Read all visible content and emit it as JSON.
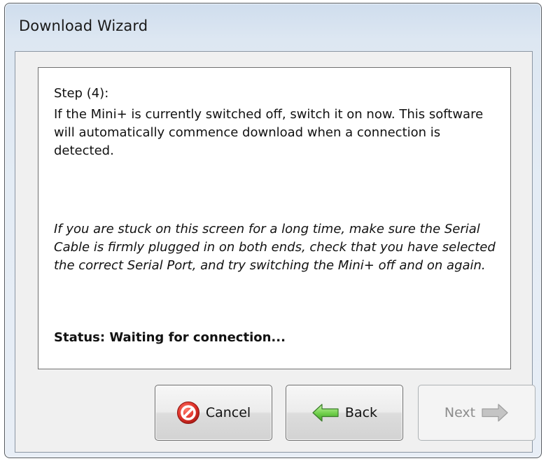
{
  "window": {
    "title": "Download Wizard"
  },
  "content": {
    "step_label": "Step (4):",
    "instructions": "If the Mini+ is currently switched off, switch it on now.  This software will automatically commence download when a connection is detected.",
    "hint": "If you are stuck on this screen for a long time, make sure the Serial Cable is firmly plugged in on both ends, check that you have selected the correct Serial Port, and try switching the Mini+ off and on again.",
    "status": "Status: Waiting for connection..."
  },
  "buttons": {
    "cancel": {
      "label": "Cancel",
      "icon": "cancel-icon",
      "enabled": true
    },
    "back": {
      "label": "Back",
      "icon": "left-arrow-icon",
      "enabled": true
    },
    "next": {
      "label": "Next",
      "icon": "right-arrow-icon",
      "enabled": false
    }
  },
  "colors": {
    "cancel_icon_red": "#e0322a",
    "back_arrow_green": "#6fcf4a",
    "next_arrow_gray": "#b5b5b5"
  }
}
